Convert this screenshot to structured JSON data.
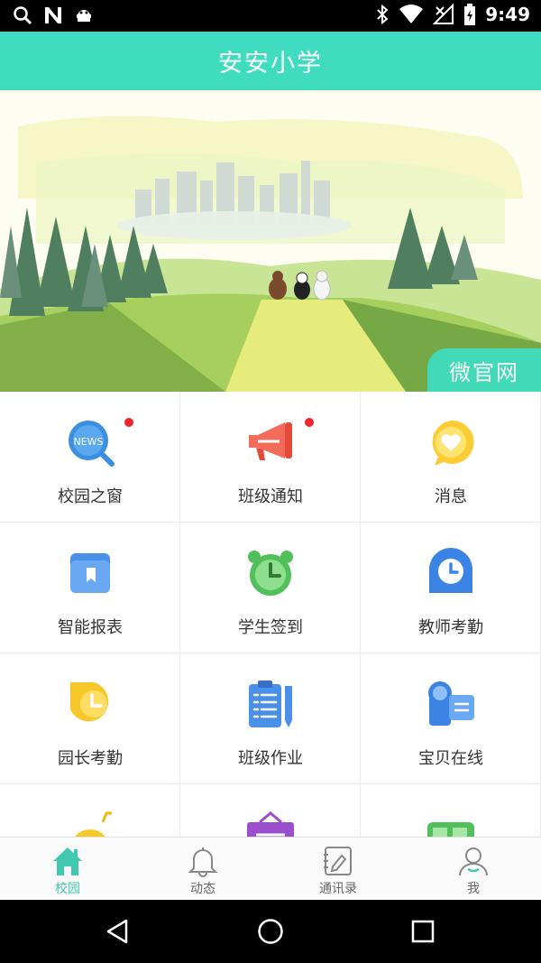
{
  "status_bar": {
    "time": "9:49",
    "left_icons": [
      "search-icon",
      "n-icon",
      "robot-icon"
    ],
    "right_icons": [
      "bluetooth-icon",
      "wifi-icon",
      "no-signal-icon",
      "battery-icon"
    ]
  },
  "header": {
    "title": "安安小学"
  },
  "banner": {
    "badge_label": "微官网"
  },
  "grid": {
    "items": [
      {
        "label": "校园之窗",
        "icon": "news-icon",
        "badge": true
      },
      {
        "label": "班级通知",
        "icon": "megaphone-icon",
        "badge": true
      },
      {
        "label": "消息",
        "icon": "message-heart-icon",
        "badge": false
      },
      {
        "label": "智能报表",
        "icon": "report-book-icon",
        "badge": false
      },
      {
        "label": "学生签到",
        "icon": "alarm-clock-icon",
        "badge": false
      },
      {
        "label": "教师考勤",
        "icon": "clock-icon",
        "badge": false
      },
      {
        "label": "园长考勤",
        "icon": "principal-clock-icon",
        "badge": false
      },
      {
        "label": "班级作业",
        "icon": "clipboard-icon",
        "badge": false
      },
      {
        "label": "宝贝在线",
        "icon": "camera-icon",
        "badge": false
      }
    ]
  },
  "tabbar": {
    "tabs": [
      {
        "label": "校园",
        "icon": "home-icon",
        "active": true
      },
      {
        "label": "动态",
        "icon": "bell-icon",
        "active": false
      },
      {
        "label": "通讯录",
        "icon": "contacts-icon",
        "active": false
      },
      {
        "label": "我",
        "icon": "person-icon",
        "active": false
      }
    ]
  },
  "colors": {
    "accent": "#40dcc0",
    "badge": "#f2242d"
  }
}
